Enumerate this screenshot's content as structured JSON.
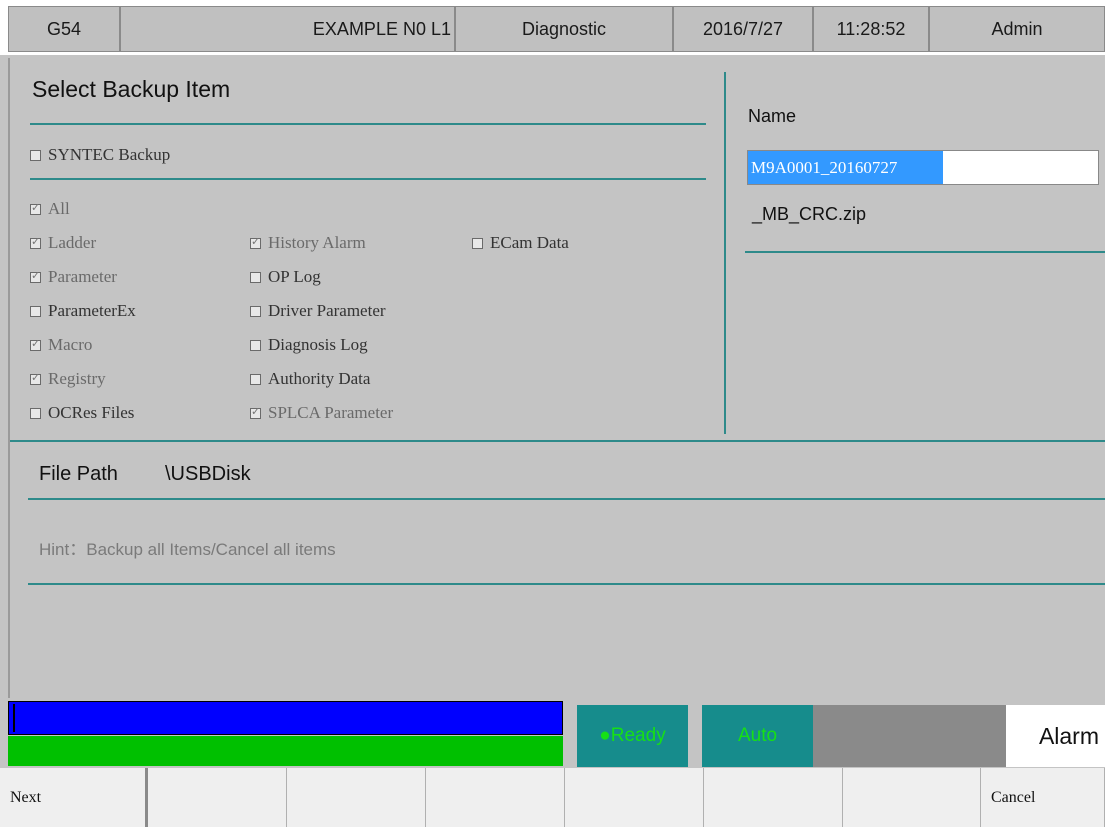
{
  "header": {
    "coord": "G54",
    "program": "EXAMPLE N0 L1",
    "mode": "Diagnostic",
    "date": "2016/7/27",
    "time": "11:28:52",
    "user": "Admin"
  },
  "backup": {
    "title": "Select Backup Item",
    "syntec": {
      "label": "SYNTEC Backup",
      "checked": false
    },
    "all": {
      "label": "All",
      "checked": true
    },
    "col1": [
      {
        "label": "Ladder",
        "checked": true
      },
      {
        "label": "Parameter",
        "checked": true
      },
      {
        "label": "ParameterEx",
        "checked": false
      },
      {
        "label": "Macro",
        "checked": true
      },
      {
        "label": "Registry",
        "checked": true
      },
      {
        "label": "OCRes Files",
        "checked": false
      }
    ],
    "col2": [
      {
        "label": "History Alarm",
        "checked": true
      },
      {
        "label": "OP Log",
        "checked": false
      },
      {
        "label": "Driver Parameter",
        "checked": false
      },
      {
        "label": "Diagnosis Log",
        "checked": false
      },
      {
        "label": "Authority Data",
        "checked": false
      },
      {
        "label": "SPLCA Parameter",
        "checked": true
      }
    ],
    "col3": [
      {
        "label": "ECam Data",
        "checked": false
      }
    ]
  },
  "name_panel": {
    "label": "Name",
    "value": "M9A0001_20160727",
    "suffix": "_MB_CRC.zip"
  },
  "file_path": {
    "label": "File Path",
    "value": "\\USBDisk"
  },
  "hint": "Hint：Backup all Items/Cancel all items",
  "status": {
    "ready": "●Ready",
    "auto": "Auto",
    "alarm": "Alarm",
    "colors": {
      "blue": "#0000ff",
      "green": "#00c000",
      "teal": "#168c8c",
      "ready_text": "#16e016"
    }
  },
  "fkeys": [
    "Next",
    "",
    "",
    "",
    "",
    "",
    "",
    "Cancel"
  ]
}
